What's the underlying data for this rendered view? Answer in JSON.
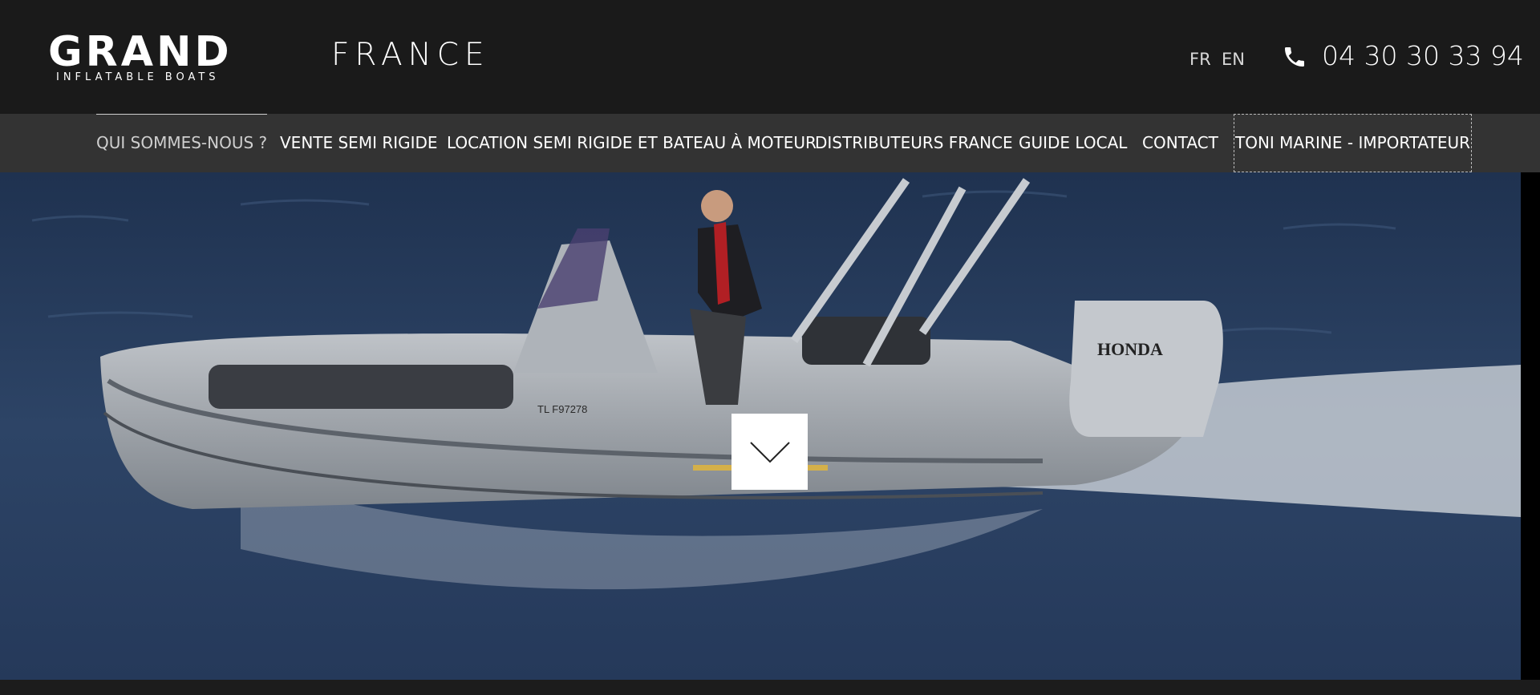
{
  "header": {
    "logo_text": "GRAND",
    "logo_subtitle": "INFLATABLE BOATS",
    "brand_region": "FRANCE",
    "languages": [
      "FR",
      "EN"
    ],
    "phone": "04 30 30 33 94",
    "phone_icon": "phone-icon"
  },
  "nav": {
    "items": [
      {
        "label": "QUI SOMMES-NOUS ?"
      },
      {
        "label": "VENTE SEMI RIGIDE"
      },
      {
        "label": "LOCATION SEMI RIGIDE ET BATEAU À MOTEUR"
      },
      {
        "label": "DISTRIBUTEURS FRANCE"
      },
      {
        "label": "GUIDE LOCAL"
      },
      {
        "label": "CONTACT"
      },
      {
        "label": "TONI MARINE - IMPORTATEUR"
      }
    ]
  },
  "hero": {
    "image_subject": "man driving a grey inflatable boat with outboard motor at speed on blue sea",
    "boat_registration": "TL F97278",
    "engine_brand": "HONDA",
    "scroll_icon": "chevron-down-icon"
  },
  "colors": {
    "header_bg": "#1a1a1a",
    "nav_bg": "#333333",
    "accent": "#d4b04a",
    "sea": "#2c3f5c"
  }
}
